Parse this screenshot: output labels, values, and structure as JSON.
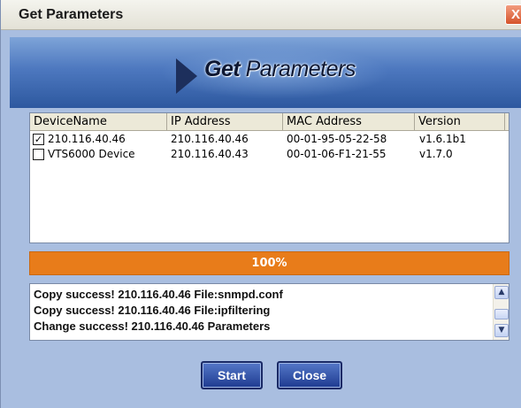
{
  "window": {
    "title": "Get Parameters",
    "close_glyph": "X"
  },
  "banner": {
    "title_bold": "Get",
    "title_rest": " Parameters",
    "icon": "arrow-right-icon"
  },
  "device_list": {
    "columns": [
      "DeviceName",
      "IP Address",
      "MAC Address",
      "Version"
    ],
    "rows": [
      {
        "checked": true,
        "name": "210.116.40.46",
        "ip": "210.116.40.46",
        "mac": "00-01-95-05-22-58",
        "version": "v1.6.1b1"
      },
      {
        "checked": false,
        "name": "VTS6000 Device",
        "ip": "210.116.40.43",
        "mac": "00-01-06-F1-21-55",
        "version": "v1.7.0"
      }
    ]
  },
  "progress": {
    "label": "100%",
    "value": 1.0,
    "color": "#e87c1a"
  },
  "log": {
    "lines": [
      "Copy success! 210.116.40.46  File:snmpd.conf",
      "Copy success! 210.116.40.46  File:ipfiltering",
      "Change success! 210.116.40.46 Parameters"
    ]
  },
  "buttons": {
    "start": "Start",
    "close": "Close"
  },
  "colors": {
    "window_bg": "#a9bee0",
    "button_bg": "#2a4aa0",
    "banner_bg": "#4d78bf"
  }
}
